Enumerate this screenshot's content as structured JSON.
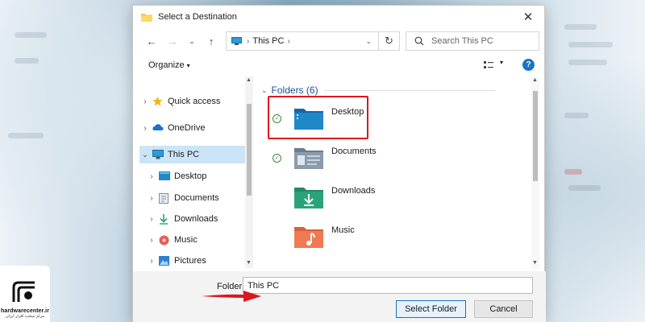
{
  "window": {
    "title": "Select a Destination"
  },
  "address_bar": {
    "location": "This PC"
  },
  "search": {
    "placeholder": "Search This PC"
  },
  "command_bar": {
    "organize_label": "Organize",
    "help_label": "?"
  },
  "nav_pane": {
    "items": [
      {
        "label": "Quick access",
        "icon": "star-icon"
      },
      {
        "label": "OneDrive",
        "icon": "cloud-icon"
      },
      {
        "label": "This PC",
        "icon": "computer-icon",
        "selected": true
      },
      {
        "label": "Desktop",
        "icon": "desktop-folder-icon"
      },
      {
        "label": "Documents",
        "icon": "documents-folder-icon"
      },
      {
        "label": "Downloads",
        "icon": "download-icon"
      },
      {
        "label": "Music",
        "icon": "music-icon"
      },
      {
        "label": "Pictures",
        "icon": "pictures-icon"
      }
    ]
  },
  "content": {
    "group_header": "Folders (6)",
    "folders": [
      {
        "label": "Desktop",
        "synced": true,
        "icon": "desktop-folder-icon"
      },
      {
        "label": "Documents",
        "synced": true,
        "icon": "documents-folder-icon"
      },
      {
        "label": "Downloads",
        "synced": false,
        "icon": "downloads-folder-icon"
      },
      {
        "label": "Music",
        "synced": false,
        "icon": "music-folder-icon"
      }
    ]
  },
  "footer": {
    "folder_label": "Folder:",
    "folder_value": "This PC",
    "select_button": "Select Folder",
    "cancel_button": "Cancel"
  },
  "watermark": {
    "brand": "hardwarecenter.ir",
    "subtitle": "مرکز سخت افزار ایران"
  },
  "colors": {
    "accent": "#1a73c9",
    "selection": "#cce4f7",
    "annotation_red": "#e0141e",
    "folder_blue": "#1e88c8",
    "folder_green": "#2aa37a",
    "folder_orange": "#f07a52"
  }
}
